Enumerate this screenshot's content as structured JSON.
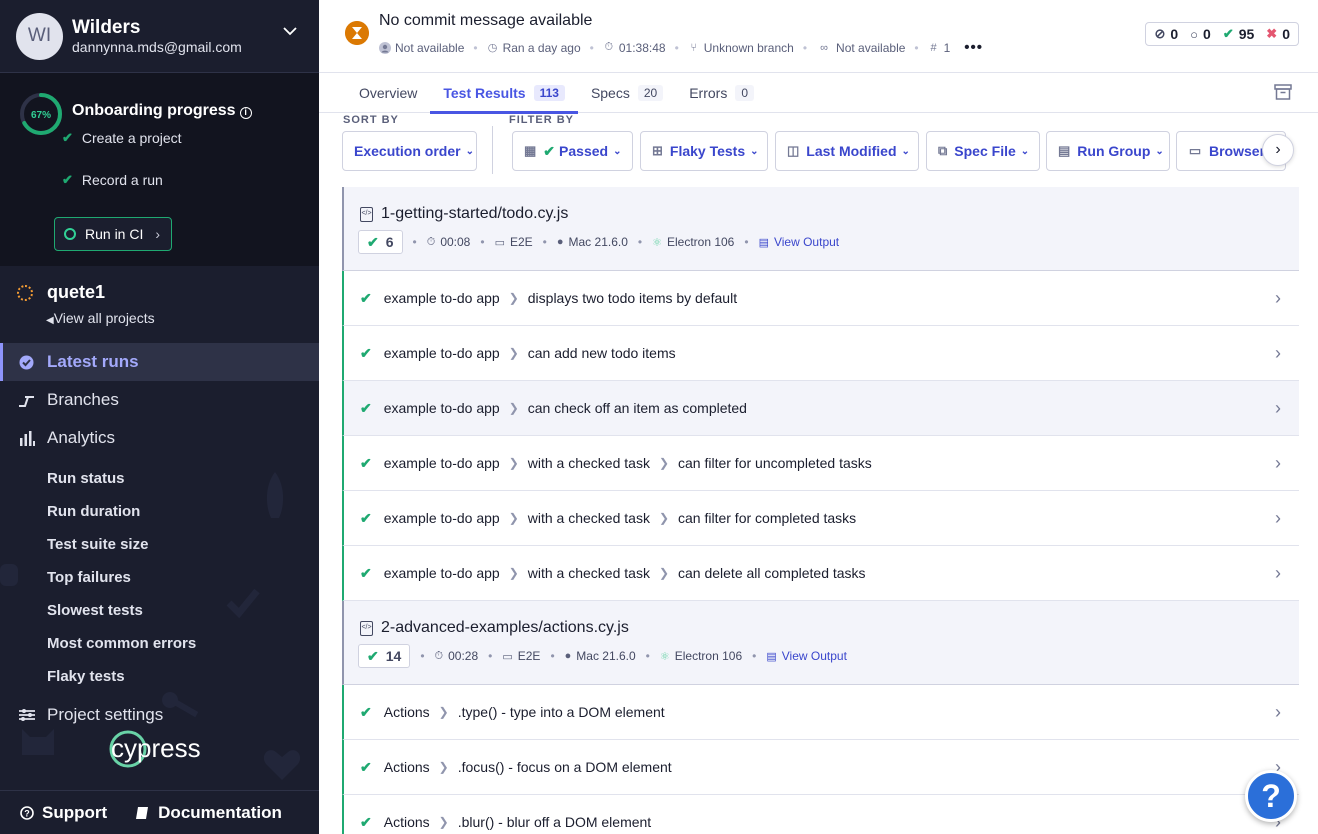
{
  "user": {
    "initials": "WI",
    "name": "Wilders",
    "email": "dannynna.mds@gmail.com"
  },
  "onboarding": {
    "percent_label": "67%",
    "progress_value": 0.67,
    "title": "Onboarding progress",
    "steps": [
      {
        "label": "Create a project",
        "done": true
      },
      {
        "label": "Record a run",
        "done": true
      }
    ],
    "run_in_ci_label": "Run in CI"
  },
  "project": {
    "name": "quete1",
    "view_all_label": "View all projects"
  },
  "nav": {
    "latest_runs": "Latest runs",
    "branches": "Branches",
    "analytics": "Analytics",
    "analytics_sub": [
      "Run status",
      "Run duration",
      "Test suite size",
      "Top failures",
      "Slowest tests",
      "Most common errors",
      "Flaky tests"
    ],
    "project_settings": "Project settings"
  },
  "logo_text": "cypress",
  "footer": {
    "support": "Support",
    "documentation": "Documentation"
  },
  "header": {
    "commit_message": "No commit message available",
    "author": "Not available",
    "ran": "Ran a day ago",
    "duration": "01:38:48",
    "branch": "Unknown branch",
    "link": "Not available",
    "run_number": "1",
    "more": "•••"
  },
  "counts": {
    "skipped": "0",
    "pending": "0",
    "passed": "95",
    "failed": "0"
  },
  "tabs": [
    {
      "label": "Overview",
      "badge": ""
    },
    {
      "label": "Test Results",
      "badge": "113"
    },
    {
      "label": "Specs",
      "badge": "20"
    },
    {
      "label": "Errors",
      "badge": "0"
    }
  ],
  "filters": {
    "sort_label": "SORT BY",
    "filter_label": "FILTER BY",
    "sort_value": "Execution order",
    "passed": "Passed",
    "flaky": "Flaky Tests",
    "last_modified": "Last Modified",
    "spec_file": "Spec File",
    "run_group": "Run Group",
    "browser": "Browser"
  },
  "specs": [
    {
      "name": "1-getting-started/todo.cy.js",
      "passed": "6",
      "duration": "00:08",
      "testing_type": "E2E",
      "os": "Mac 21.6.0",
      "browser": "Electron 106",
      "view_output": "View Output",
      "tests": [
        {
          "path": [
            "example to-do app",
            "displays two todo items by default"
          ]
        },
        {
          "path": [
            "example to-do app",
            "can add new todo items"
          ]
        },
        {
          "path": [
            "example to-do app",
            "can check off an item as completed"
          ]
        },
        {
          "path": [
            "example to-do app",
            "with a checked task",
            "can filter for uncompleted tasks"
          ]
        },
        {
          "path": [
            "example to-do app",
            "with a checked task",
            "can filter for completed tasks"
          ]
        },
        {
          "path": [
            "example to-do app",
            "with a checked task",
            "can delete all completed tasks"
          ]
        }
      ]
    },
    {
      "name": "2-advanced-examples/actions.cy.js",
      "passed": "14",
      "duration": "00:28",
      "testing_type": "E2E",
      "os": "Mac 21.6.0",
      "browser": "Electron 106",
      "view_output": "View Output",
      "tests": [
        {
          "path": [
            "Actions",
            ".type() - type into a DOM element"
          ]
        },
        {
          "path": [
            "Actions",
            ".focus() - focus on a DOM element"
          ]
        },
        {
          "path": [
            "Actions",
            ".blur() - blur off a DOM element"
          ]
        }
      ]
    }
  ],
  "help_label": "?",
  "colors": {
    "sidebar_bg": "#1b1e2e",
    "accent": "#4956e3",
    "pass": "#1fa971",
    "fail": "#e45770",
    "running": "#db7903"
  }
}
